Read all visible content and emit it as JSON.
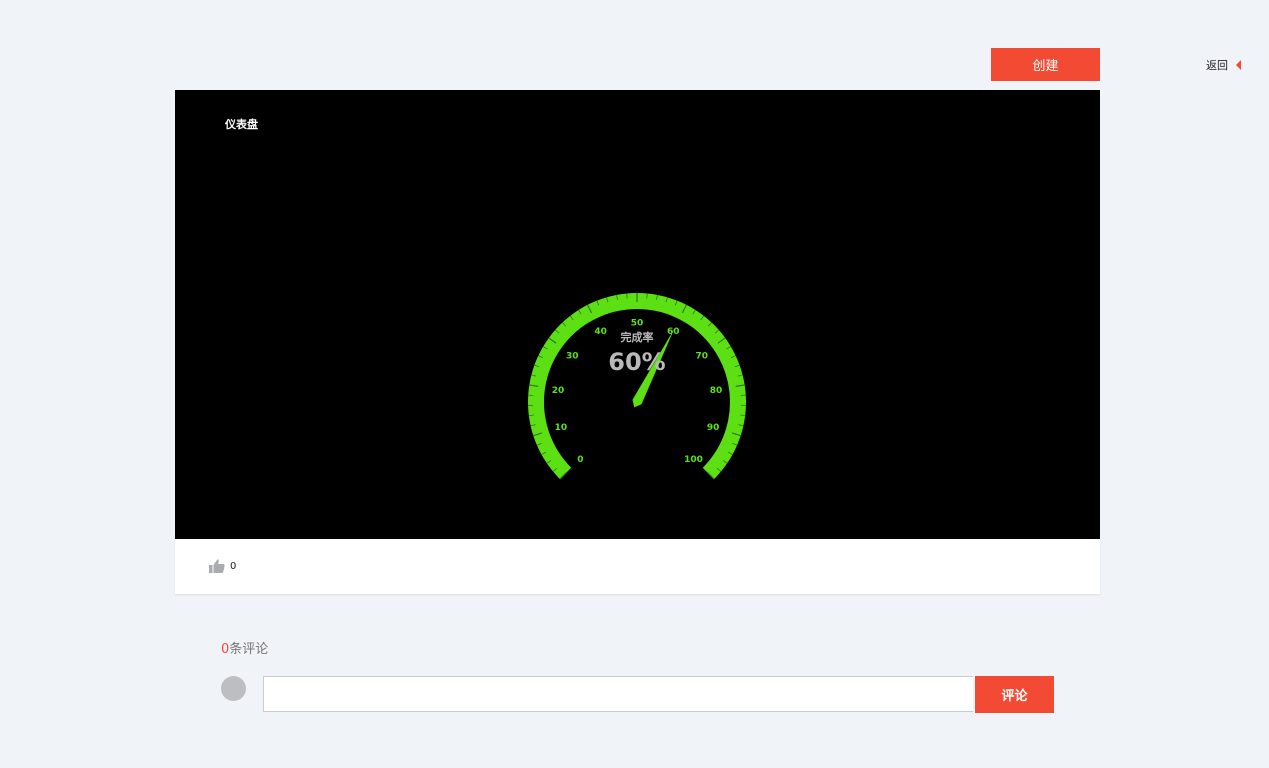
{
  "header": {
    "create_label": "创建",
    "back_label": "返回"
  },
  "panel": {
    "title": "仪表盘",
    "gauge": {
      "label": "完成率",
      "value_text": "60%",
      "value": 60,
      "min": 0,
      "max": 100,
      "ticks": [
        "0",
        "10",
        "20",
        "30",
        "40",
        "50",
        "60",
        "70",
        "80",
        "90",
        "100"
      ],
      "color": "#5de013",
      "label_color": "#b9b9b9"
    }
  },
  "footer": {
    "like_count": "0"
  },
  "comments": {
    "count": "0",
    "count_suffix": "条评论",
    "input_value": "",
    "submit_label": "评论"
  },
  "colors": {
    "accent": "#f34a33",
    "background": "#f0f3f8"
  }
}
